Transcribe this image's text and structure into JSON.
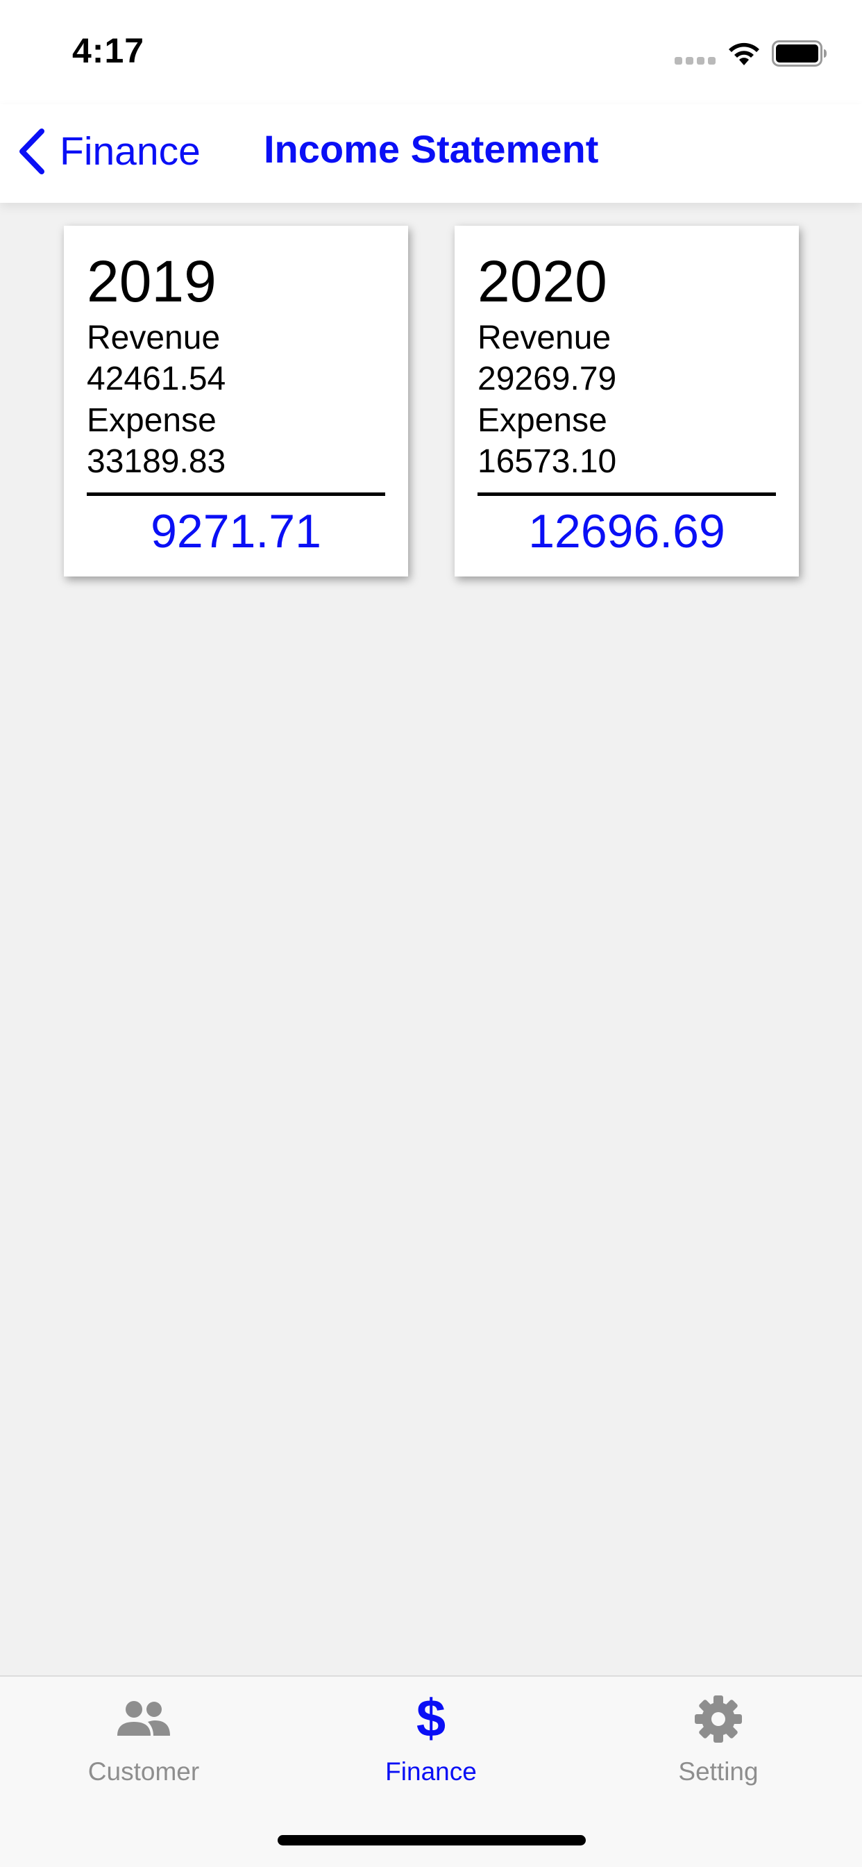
{
  "status_bar": {
    "time": "4:17"
  },
  "nav": {
    "back_label": "Finance",
    "title": "Income Statement"
  },
  "cards": [
    {
      "year": "2019",
      "revenue_label": "Revenue",
      "revenue_value": "42461.54",
      "expense_label": "Expense",
      "expense_value": "33189.83",
      "net_value": "9271.71"
    },
    {
      "year": "2020",
      "revenue_label": "Revenue",
      "revenue_value": "29269.79",
      "expense_label": "Expense",
      "expense_value": "16573.10",
      "net_value": "12696.69"
    }
  ],
  "tabs": [
    {
      "label": "Customer",
      "icon": "people-icon",
      "active": false
    },
    {
      "label": "Finance",
      "icon": "dollar-icon",
      "active": true
    },
    {
      "label": "Setting",
      "icon": "gear-icon",
      "active": false
    }
  ],
  "colors": {
    "accent": "#0a0ff5",
    "background": "#f1f1f1",
    "inactive_tab": "#8e8e8e"
  }
}
